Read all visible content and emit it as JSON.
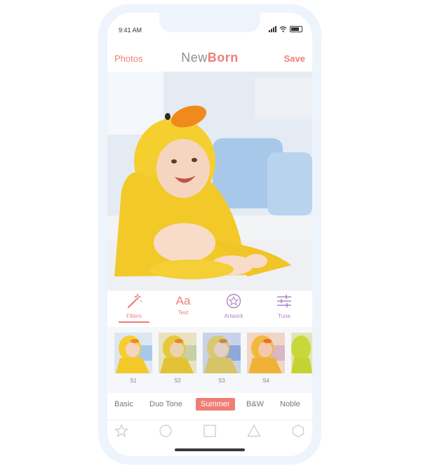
{
  "status_bar": {
    "time": "9:41 AM"
  },
  "navbar": {
    "left_label": "Photos",
    "title_part1": "New",
    "title_part2": "Born",
    "right_label": "Save"
  },
  "photo": {
    "subject": "baby in yellow duck hooded towel"
  },
  "tabs": [
    {
      "label": "Filters",
      "icon": "magic-wand-icon",
      "active": true
    },
    {
      "label": "Text",
      "icon": "text-aa-icon",
      "active": false
    },
    {
      "label": "Artwork",
      "icon": "star-circle-icon",
      "active": false
    },
    {
      "label": "Tune",
      "icon": "sliders-icon",
      "active": false
    }
  ],
  "filters": [
    {
      "label": "S1"
    },
    {
      "label": "S2"
    },
    {
      "label": "S3"
    },
    {
      "label": "S4"
    },
    {
      "label": ""
    }
  ],
  "categories": [
    {
      "label": "Basic"
    },
    {
      "label": "Duo Tone"
    },
    {
      "label": "Summer",
      "active": true
    },
    {
      "label": "B&W"
    },
    {
      "label": "Noble"
    }
  ],
  "shapes": [
    "star-shape-icon",
    "circle-shape-icon",
    "square-shape-icon",
    "triangle-shape-icon",
    "hexagon-shape-icon"
  ],
  "colors": {
    "accent": "#f07e76",
    "logo_gray": "#8e8e96",
    "active_tab": "#f07e76",
    "inactive_tab": "#b085c9",
    "phone_frame": "#eef4fb"
  }
}
